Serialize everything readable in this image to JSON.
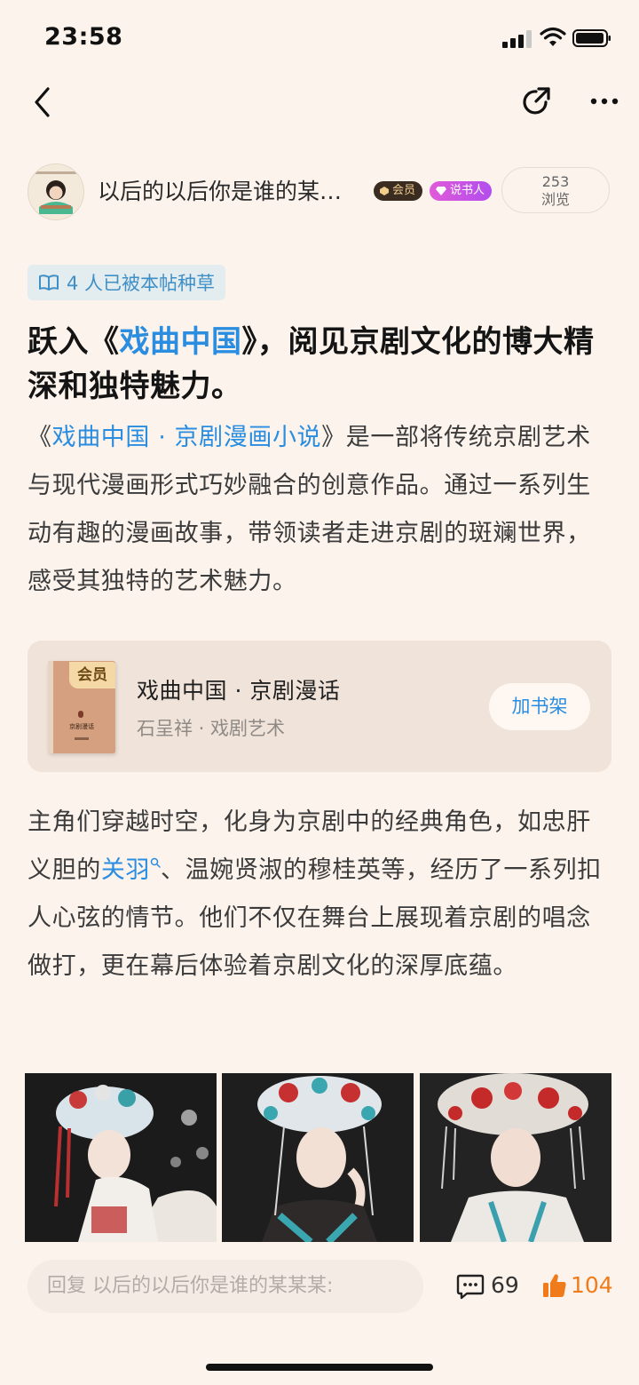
{
  "status_bar": {
    "time": "23:58"
  },
  "author": {
    "name": "以后的以后你是谁的某…",
    "member_badge": "会员",
    "storyteller_badge": "说书人",
    "views_count": "253",
    "views_label": "浏览"
  },
  "grass_badge": "4 人已被本帖种草",
  "title": {
    "prefix": "跃入《",
    "link": "戏曲中国",
    "suffix": "》，阅见京剧文化的博大精深和独特魅力。"
  },
  "intro": {
    "open": "《",
    "link": "戏曲中国 · 京剧漫画小说",
    "rest": "》是一部将传统京剧艺术与现代漫画形式巧妙融合的创意作品。通过一系列生动有趣的漫画故事，带领读者走进京剧的斑斓世界，感受其独特的艺术魅力。"
  },
  "book": {
    "tag": "会员",
    "title": "戏曲中国 · 京剧漫话",
    "subtitle": "石呈祥 · 戏剧艺术",
    "button": "加书架"
  },
  "body": {
    "before": "主角们穿越时空，化身为京剧中的经典角色，如忠肝义胆的",
    "link": "关羽",
    "after": "、温婉贤淑的穆桂英等，经历了一系列扣人心弦的情节。他们不仅在舞台上展现着京剧的唱念做打，更在幕后体验着京剧文化的深厚底蕴。"
  },
  "bottom_bar": {
    "reply_placeholder": "回复 以后的以后你是谁的某某某:",
    "comments": "69",
    "likes": "104"
  },
  "colors": {
    "link": "#2a8de0",
    "like": "#f07b1a",
    "background": "#fcf3ec"
  },
  "icons": [
    "back-icon",
    "share-icon",
    "more-icon",
    "comment-icon",
    "like-icon",
    "book-icon"
  ]
}
